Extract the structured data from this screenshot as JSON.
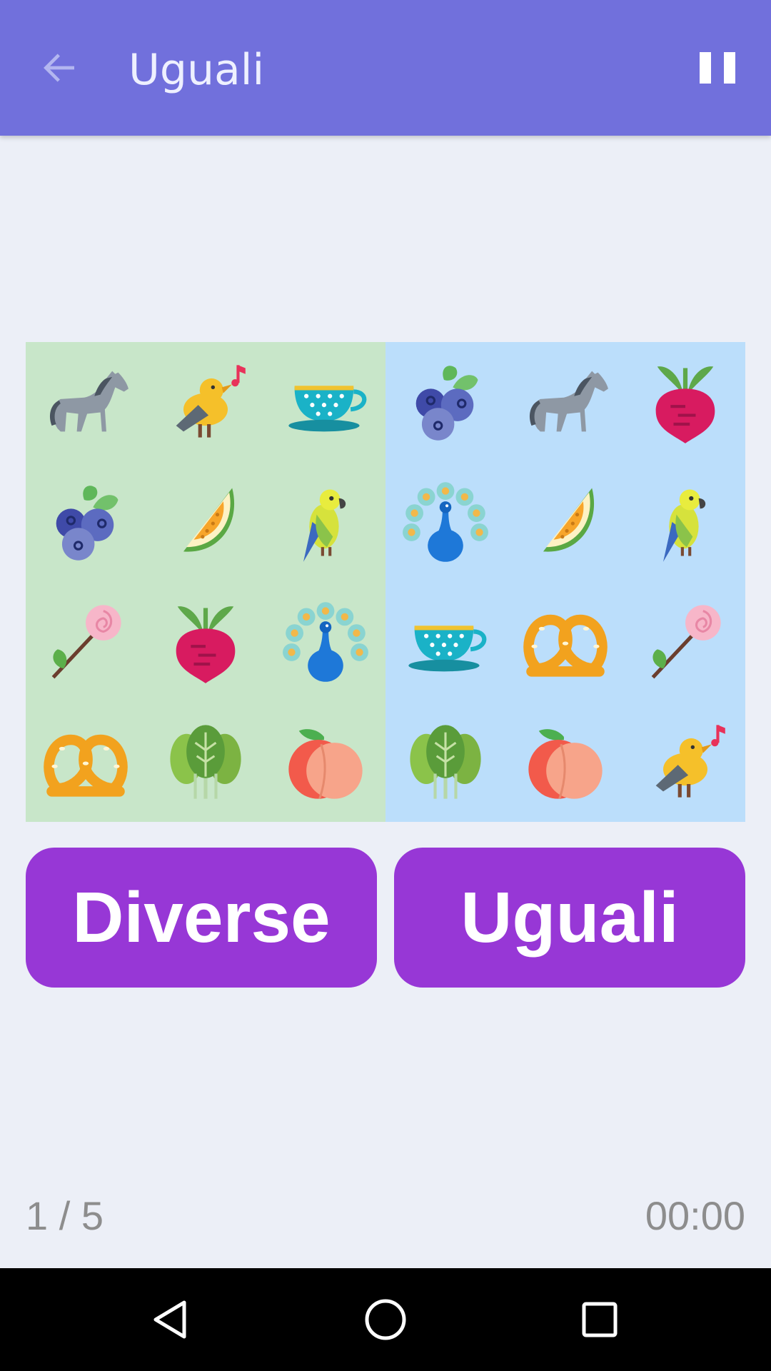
{
  "app_bar": {
    "title": "Uguali",
    "back_icon": "arrow-left-icon",
    "pause_icon": "pause-icon",
    "color": "#7170dc"
  },
  "board": {
    "left_panel": {
      "color": "#c8e6c9",
      "items": [
        "horse",
        "singing-bird",
        "teacup",
        "blueberries",
        "melon",
        "parrot",
        "rose",
        "beet",
        "peacock",
        "pretzel",
        "leafy-greens",
        "peach"
      ]
    },
    "right_panel": {
      "color": "#bbdefb",
      "items": [
        "blueberries",
        "horse",
        "beet",
        "peacock",
        "melon",
        "parrot",
        "teacup",
        "pretzel",
        "rose",
        "leafy-greens",
        "peach",
        "singing-bird"
      ]
    }
  },
  "buttons": {
    "diverse_label": "Diverse",
    "uguali_label": "Uguali",
    "color": "#9737d6"
  },
  "footer": {
    "progress": "1 / 5",
    "timer": "00:00"
  },
  "nav": {
    "back_icon": "nav-back-icon",
    "home_icon": "nav-home-icon",
    "recents_icon": "nav-recents-icon"
  }
}
